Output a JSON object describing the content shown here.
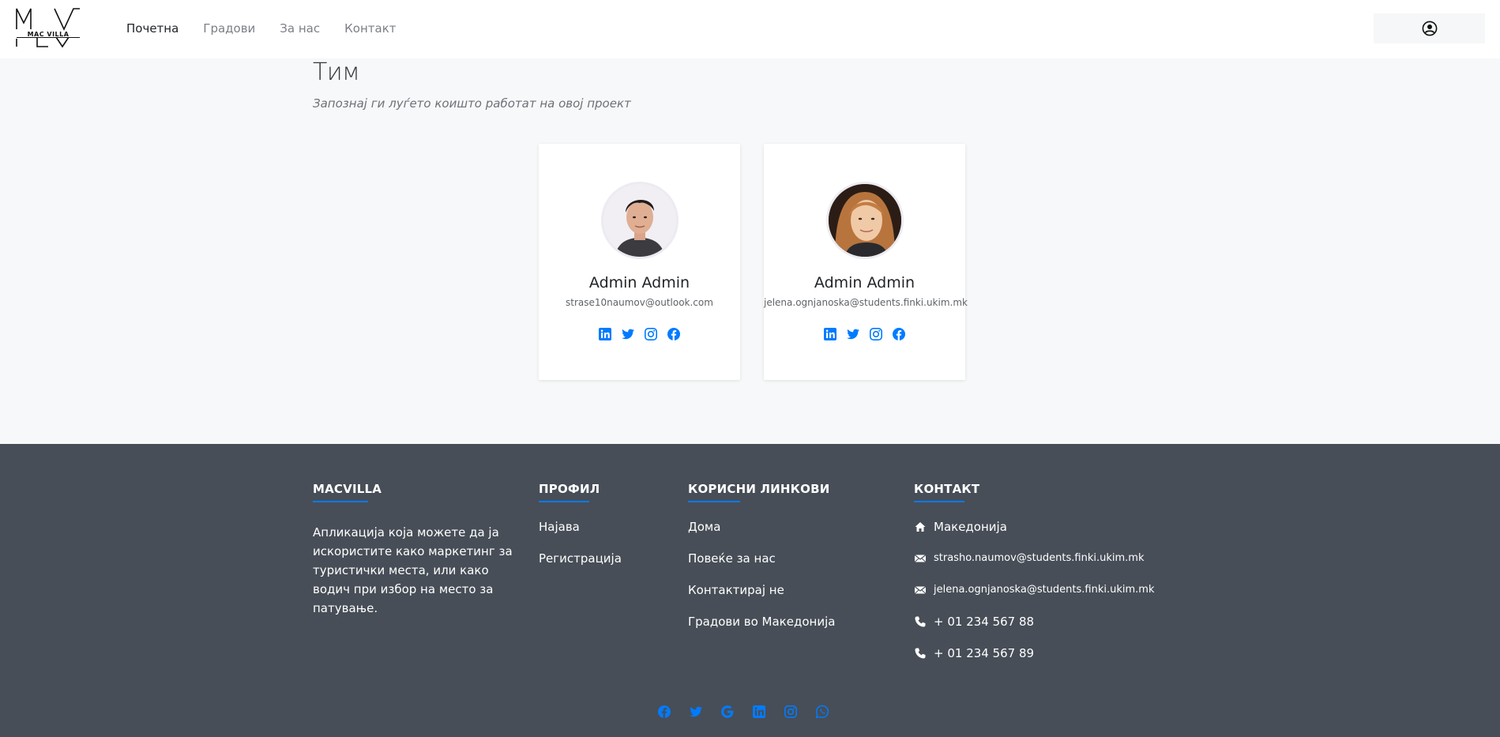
{
  "brand": {
    "logo_text": "MAC VILLA"
  },
  "nav": {
    "items": [
      {
        "label": "Почетна",
        "active": true
      },
      {
        "label": "Градови",
        "active": false
      },
      {
        "label": "За нас",
        "active": false
      },
      {
        "label": "Контакт",
        "active": false
      }
    ]
  },
  "team": {
    "title": "Тим",
    "subtitle": "Запознај ги луѓето коишто работат на овој проект",
    "members": [
      {
        "name": "Admin Admin",
        "email": "strase10naumov@outlook.com",
        "socials": [
          "linkedin-icon",
          "twitter-icon",
          "instagram-icon",
          "facebook-icon"
        ]
      },
      {
        "name": "Admin Admin",
        "email": "jelena.ognjanoska@students.finki.ukim.mk",
        "socials": [
          "linkedin-icon",
          "twitter-icon",
          "instagram-icon",
          "facebook-icon"
        ]
      }
    ]
  },
  "footer": {
    "about": {
      "heading": "MACVILLA",
      "text": "Апликација која можете да ја искористите како маркетинг за туристички места, или како водич при избор на место за патување."
    },
    "profile": {
      "heading": "ПРОФИЛ",
      "links": [
        "Најава",
        "Регистрација"
      ]
    },
    "useful": {
      "heading": "КОРИСНИ ЛИНКОВИ",
      "links": [
        "Дома",
        "Повеќе за нас",
        "Контактирај не",
        "Градови во Македонија"
      ]
    },
    "contact": {
      "heading": "КОНТАКТ",
      "location": "Македонија",
      "email1": "strasho.naumov@students.finki.ukim.mk",
      "email2": "jelena.ognjanoska@students.finki.ukim.mk",
      "phone1": "+ 01 234 567 88",
      "phone2": "+ 01 234 567 89"
    },
    "social_icons": [
      "facebook-icon",
      "twitter-icon",
      "google-icon",
      "linkedin-icon",
      "instagram-icon",
      "whatsapp-icon"
    ]
  },
  "colors": {
    "accent": "#007bff",
    "footer_bg": "#474e57",
    "page_bg": "#f7f8f9"
  }
}
